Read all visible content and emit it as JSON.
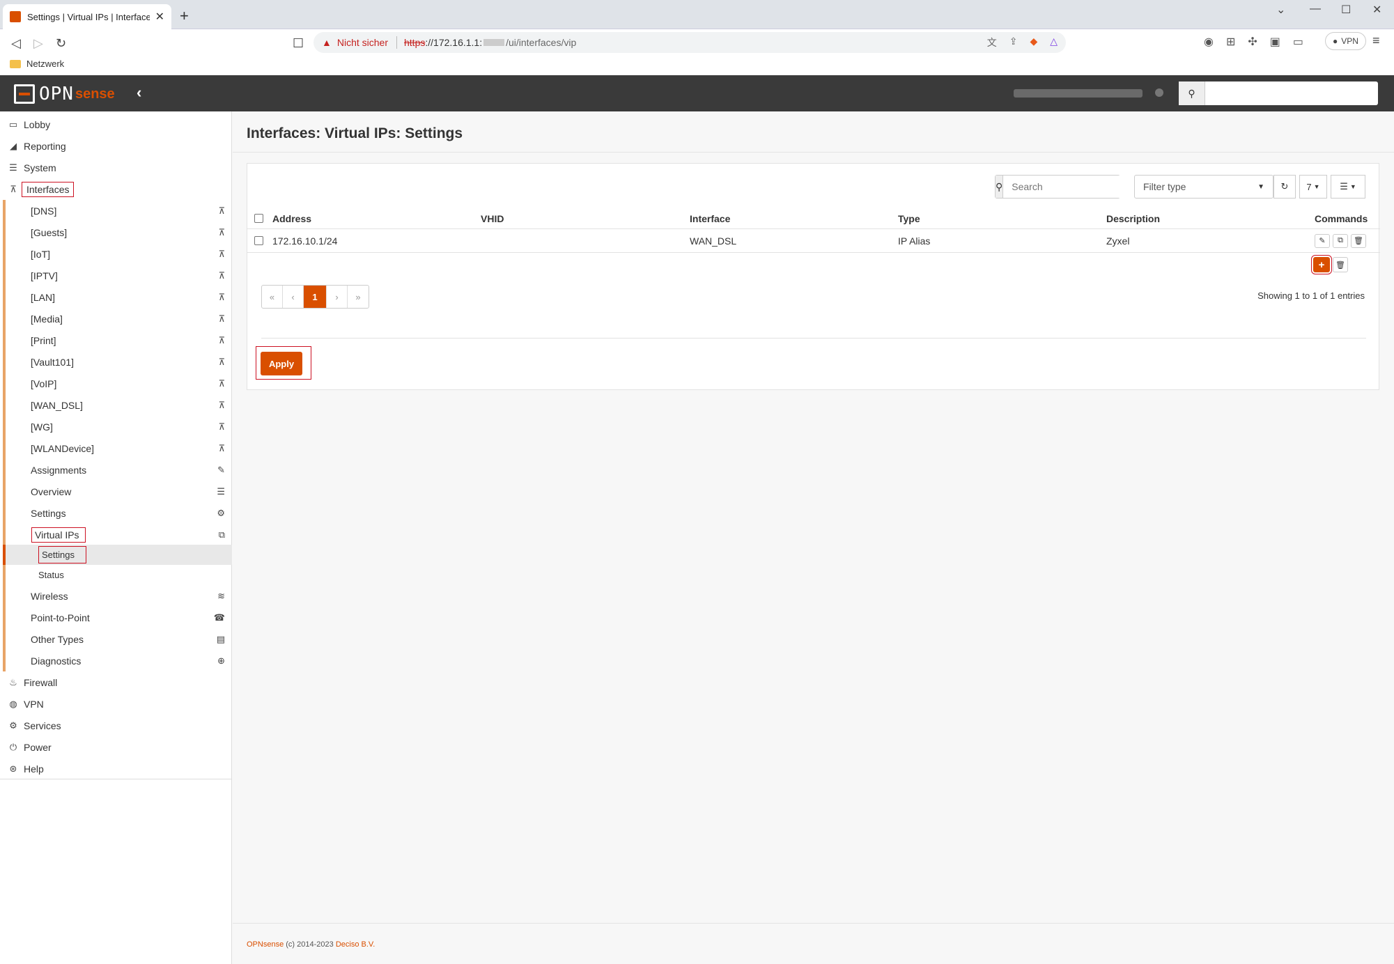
{
  "browser": {
    "tab_title": "Settings | Virtual IPs | Interfaces |",
    "tab_close": "✕",
    "new_tab": "+",
    "warning_text": "Nicht sicher",
    "url_scheme": "https",
    "url_host": "://172.16.1.1:",
    "url_path": "/ui/interfaces/vip",
    "bookmark_folder": "Netzwerk",
    "vpn_label": "VPN",
    "accent_color": "#d94f00"
  },
  "app": {
    "logo_opn": "OPN",
    "logo_sense": "sense"
  },
  "sidebar": {
    "lobby": "Lobby",
    "reporting": "Reporting",
    "system": "System",
    "interfaces": "Interfaces",
    "interface_items": [
      "[DNS]",
      "[Guests]",
      "[IoT]",
      "[IPTV]",
      "[LAN]",
      "[Media]",
      "[Print]",
      "[Vault101]",
      "[VoIP]",
      "[WAN_DSL]",
      "[WG]",
      "[WLANDevice]"
    ],
    "assignments": "Assignments",
    "overview": "Overview",
    "settings": "Settings",
    "virtual_ips": "Virtual IPs",
    "vip_settings": "Settings",
    "vip_status": "Status",
    "wireless": "Wireless",
    "point_to_point": "Point-to-Point",
    "other_types": "Other Types",
    "diagnostics": "Diagnostics",
    "firewall": "Firewall",
    "vpn": "VPN",
    "services": "Services",
    "power": "Power",
    "help": "Help"
  },
  "page": {
    "title": "Interfaces: Virtual IPs: Settings",
    "search_placeholder": "Search",
    "filter_type": "Filter type",
    "row_count": "7",
    "columns": [
      "Address",
      "VHID",
      "Interface",
      "Type",
      "Description",
      "Commands"
    ],
    "rows": [
      {
        "address": "172.16.10.1/24",
        "vhid": "",
        "interface": "WAN_DSL",
        "type": "IP Alias",
        "description": "Zyxel"
      }
    ],
    "pager": [
      "«",
      "‹",
      "1",
      "›",
      "»"
    ],
    "showing": "Showing 1 to 1 of 1 entries",
    "apply_label": "Apply"
  },
  "footer": {
    "brand": "OPNsense",
    "copy": " (c) 2014-2023 ",
    "company": "Deciso B.V."
  }
}
